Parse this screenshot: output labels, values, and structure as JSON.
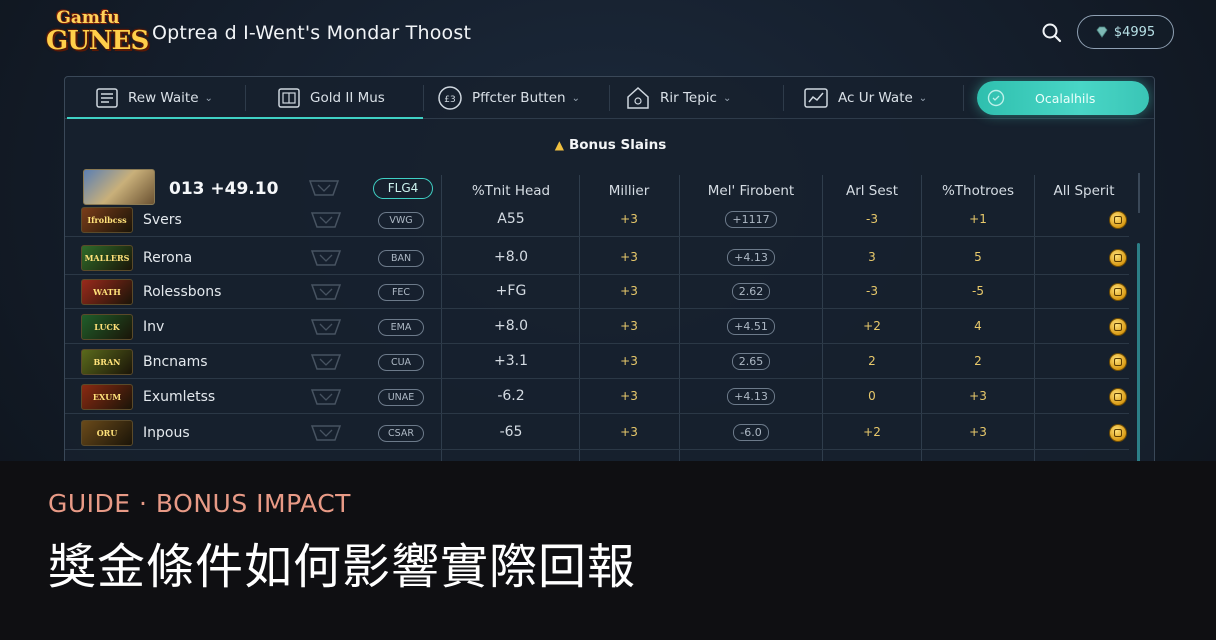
{
  "app": {
    "logo_line1": "Gamfu",
    "logo_line2": "GUNES",
    "title": "Optrea d I-Went's Mondar Thoost",
    "balance": "$4995"
  },
  "tabs": [
    {
      "label": "Rew Waite",
      "chevron": "⌄",
      "icon": "list-icon"
    },
    {
      "label": "Gold II Mus",
      "chevron": "",
      "icon": "grid-icon"
    },
    {
      "label": "Pffcter Butten",
      "chevron": "⌄",
      "icon": "badge-icon"
    },
    {
      "label": "Rir Tepic",
      "chevron": "⌄",
      "icon": "house-icon"
    },
    {
      "label": "Ac Ur Wate",
      "chevron": "⌄",
      "icon": "chart-icon"
    }
  ],
  "cta": {
    "label": "Ocalalhils",
    "icon": "shield-icon"
  },
  "section_title": "Bonus Slains",
  "top_game": {
    "value": "013 +49.10",
    "featured": "FLG4"
  },
  "columns": [
    "%Tnit Head",
    "Millier",
    "Mel' Firobent",
    "Arl Sest",
    "%Thotroes",
    "All Sperit"
  ],
  "rows": [
    {
      "thumb": "Ifrolbcss",
      "name": "Svers",
      "tag": "VWG",
      "head": "A55",
      "millier": "+3",
      "mel": "+1117",
      "arl": "-3",
      "thot": "+1",
      "thumb_bg": "#7a3d1a"
    },
    {
      "thumb": "MALLERS",
      "name": "Rerona",
      "tag": "BAN",
      "head": "+8.0",
      "millier": "+3",
      "mel": "+4.13",
      "arl": "3",
      "thot": "5",
      "thumb_bg": "#2f6b2a"
    },
    {
      "thumb": "WATH",
      "name": "Rolessbons",
      "tag": "FEC",
      "head": "+FG",
      "millier": "+3",
      "mel": "2.62",
      "arl": "-3",
      "thot": "-5",
      "thumb_bg": "#9a2a1c"
    },
    {
      "thumb": "LUCK",
      "name": "Inv",
      "tag": "EMA",
      "head": "+8.0",
      "millier": "+3",
      "mel": "+4.51",
      "arl": "+2",
      "thot": "4",
      "thumb_bg": "#1f5e2a"
    },
    {
      "thumb": "BRAN",
      "name": "Bncnams",
      "tag": "CUA",
      "head": "+3.1",
      "millier": "+3",
      "mel": "2.65",
      "arl": "2",
      "thot": "2",
      "thumb_bg": "#5a6a1c"
    },
    {
      "thumb": "EXUM",
      "name": "Exumletss",
      "tag": "UNAE",
      "head": "-6.2",
      "millier": "+3",
      "mel": "+4.13",
      "arl": "0",
      "thot": "+3",
      "thumb_bg": "#8a2a12"
    },
    {
      "thumb": "ORU",
      "name": "Inpous",
      "tag": "CSAR",
      "head": "-65",
      "millier": "+3",
      "mel": "-6.0",
      "arl": "+2",
      "thot": "+3",
      "thumb_bg": "#6a4a1a"
    }
  ],
  "caption": {
    "kicker": "GUIDE ·   BONUS IMPACT",
    "headline": "獎金條件如何影響實際回報"
  },
  "colors": {
    "accent": "#3fd0c4",
    "coin": "#e0a41c",
    "caption_bg": "#0f0f12",
    "kicker": "#e89a86"
  }
}
